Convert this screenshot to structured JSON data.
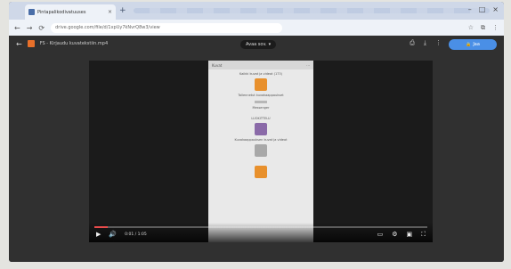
{
  "browser": {
    "tab_title": "Pintapalikodivatuuses",
    "tab_close": "×",
    "new_tab": "+",
    "win_min": "–",
    "win_max": "□",
    "win_close": "×",
    "nav_back": "←",
    "nav_forward": "→",
    "nav_reload": "⟳",
    "url": "drive.google.com/file/d/1xpUy7kNvrQ8w3/view",
    "icon_star": "☆",
    "icon_ext": "⧉",
    "icon_menu": "⋮"
  },
  "viewer": {
    "back_arrow": "←",
    "file_name": "FS - Kirjaudu kuvatekstiin.mp4",
    "open_with": "Avaa sov.",
    "open_with_caret": "▾",
    "icon_print": "⎙",
    "icon_download": "⤓",
    "icon_more": "⋮",
    "share_label": "Jaa",
    "share_icon": "🔒"
  },
  "phone": {
    "top_title": "Kuvat",
    "top_icon": "⋯",
    "lines": [
      "Kaikki kuvat ja videot (173)",
      "Tallennetut kuvakaappaukset",
      "Messenger",
      "LUOKITTELU",
      "Kuvakaappauksen kuvat ja videot"
    ]
  },
  "player": {
    "progress_fraction": 0.04,
    "play_icon": "▶",
    "volume_icon": "🔊",
    "time": "0:01 / 1:05",
    "icon_cc": "▭",
    "icon_settings": "⚙",
    "icon_theater": "▣",
    "icon_fullscreen": "⛶"
  },
  "colors": {
    "tile_orange": "#e8902c",
    "tile_purple": "#8a6aa8",
    "tile_gray": "#a8a8a8",
    "progress_red": "#e94b4b",
    "share_blue": "#4a8fe6"
  }
}
